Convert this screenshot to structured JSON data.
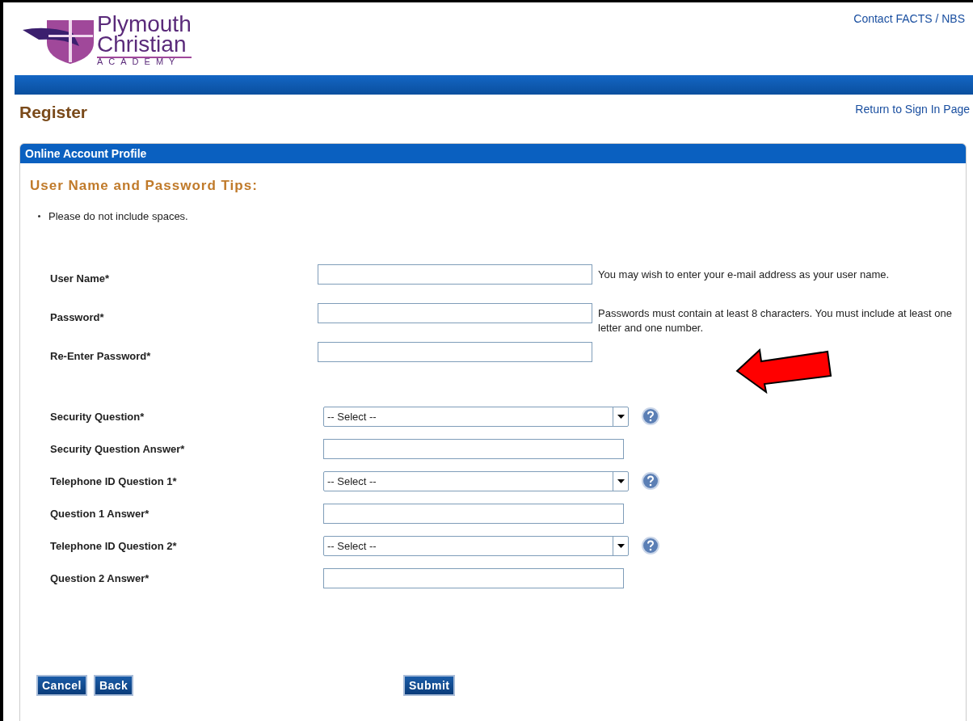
{
  "logo": {
    "line_1": "Plymouth",
    "line_2": "Christian",
    "line_3": "ACADEMY"
  },
  "header_links": [
    "Contact FACTS / NBS"
  ],
  "page_title": "Register",
  "return_link": "Return to Sign In Page",
  "panel": {
    "title": "Online Account Profile",
    "tips_title": "User Name and Password Tips:",
    "tips": [
      "Please do not include spaces."
    ],
    "account_fields": [
      {
        "kind": "text",
        "label": "User Name*",
        "hint": "You may wish to enter your e-mail address as your user name."
      },
      {
        "kind": "text",
        "label": "Password*",
        "hint": "Passwords must contain at least 8 characters. You must include at least one letter and one number."
      },
      {
        "kind": "text",
        "label": "Re-Enter Password*"
      }
    ],
    "question_fields": [
      {
        "kind": "select",
        "label": "Security Question*",
        "value": "-- Select --"
      },
      {
        "kind": "text",
        "label": "Security Question Answer*"
      },
      {
        "kind": "select",
        "label": "Telephone ID Question 1*",
        "value": "-- Select --"
      },
      {
        "kind": "text",
        "label": "Question 1 Answer*"
      },
      {
        "kind": "select",
        "label": "Telephone ID Question 2*",
        "value": "-- Select --"
      },
      {
        "kind": "text",
        "label": "Question 2 Answer*"
      }
    ],
    "left_buttons": [
      "Cancel",
      "Back"
    ],
    "submit_button": "Submit"
  }
}
